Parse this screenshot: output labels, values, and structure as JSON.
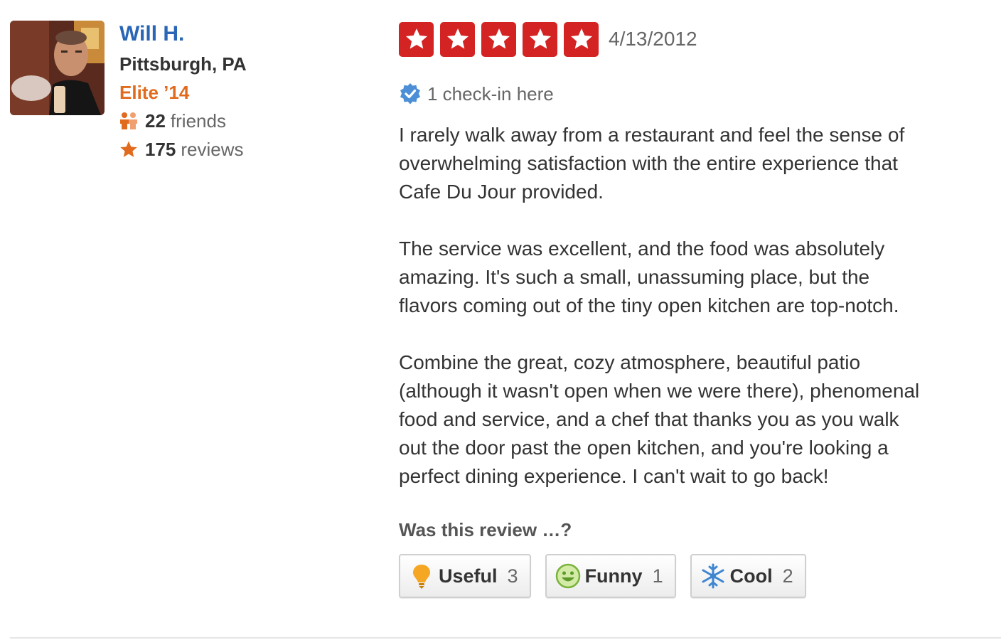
{
  "user": {
    "name": "Will H.",
    "location": "Pittsburgh, PA",
    "elite": "Elite ’14",
    "friends_count": "22",
    "friends_label": "friends",
    "reviews_count": "175",
    "reviews_label": "reviews"
  },
  "review": {
    "rating": 5,
    "rating_max": 5,
    "date": "4/13/2012",
    "checkin": "1 check-in here",
    "paragraphs": [
      "I rarely walk away from a restaurant and feel the sense of\noverwhelming satisfaction with the entire experience that\nCafe Du Jour provided.",
      "The service was excellent, and the food was absolutely\namazing. It's such a small, unassuming place, but the\nflavors coming out of the tiny open kitchen are top-notch.",
      "Combine the great, cozy atmosphere, beautiful patio\n(although it wasn't open when we were there), phenomenal\nfood and service, and a chef that thanks you as you walk\nout the door past the open kitchen, and you're looking a\nperfect dining experience. I can't wait to go back!"
    ]
  },
  "votes": {
    "prompt": "Was this review …?",
    "buttons": [
      {
        "label": "Useful",
        "count": "3",
        "icon": "lightbulb-icon"
      },
      {
        "label": "Funny",
        "count": "1",
        "icon": "smiley-icon"
      },
      {
        "label": "Cool",
        "count": "2",
        "icon": "snowflake-icon"
      }
    ]
  },
  "colors": {
    "star": "#d32323",
    "user_link": "#2a66b6",
    "elite": "#e06b1e",
    "checkin": "#4d8fd6"
  }
}
